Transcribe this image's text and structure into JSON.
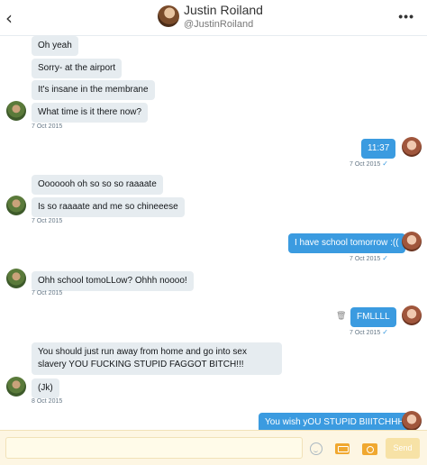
{
  "header": {
    "back_icon": "chevron-left",
    "name": "Justin Roiland",
    "handle": "@JustinRoiland",
    "more_icon": "ellipsis"
  },
  "messages": [
    {
      "side": "in",
      "text": "Oh yeah"
    },
    {
      "side": "in",
      "text": "Sorry- at the airport"
    },
    {
      "side": "in",
      "text": "It's insane in the membrane"
    },
    {
      "side": "in",
      "text": "What time is it there now?",
      "timestamp": "7 Oct 2015"
    },
    {
      "side": "out",
      "text": "11:37",
      "timestamp": "7 Oct 2015",
      "status": "✓"
    },
    {
      "side": "in",
      "text": "Ooooooh oh so so so raaaate"
    },
    {
      "side": "in",
      "text": "Is so raaaate and me so chineeese",
      "timestamp": "7 Oct 2015"
    },
    {
      "side": "out",
      "text": "I have school tomorrow :((",
      "timestamp": "7 Oct 2015",
      "status": "✓"
    },
    {
      "side": "in",
      "text": "Ohh school tomoLLow? Ohhh noooo!",
      "timestamp": "7 Oct 2015"
    },
    {
      "side": "out",
      "text": "FMLLLL",
      "timestamp": "7 Oct 2015",
      "status": "✓"
    },
    {
      "side": "in",
      "text": "You should just run away from home and go into sex slavery YOU FUCKING STUPID FAGGOT BITCH!!!"
    },
    {
      "side": "in",
      "text": "(Jk)",
      "timestamp": "8 Oct 2015"
    },
    {
      "side": "out",
      "text": "You wish yOU STUPID BIIITCHHH"
    }
  ],
  "composer": {
    "placeholder": "",
    "emoji_icon": "emoji",
    "gif_icon": "gif",
    "camera_icon": "camera",
    "send_label": "Send"
  },
  "colors": {
    "incoming_bubble": "#e6ecf0",
    "outgoing_bubble": "#3b9be0",
    "composer_bg": "#fdf6e3"
  }
}
